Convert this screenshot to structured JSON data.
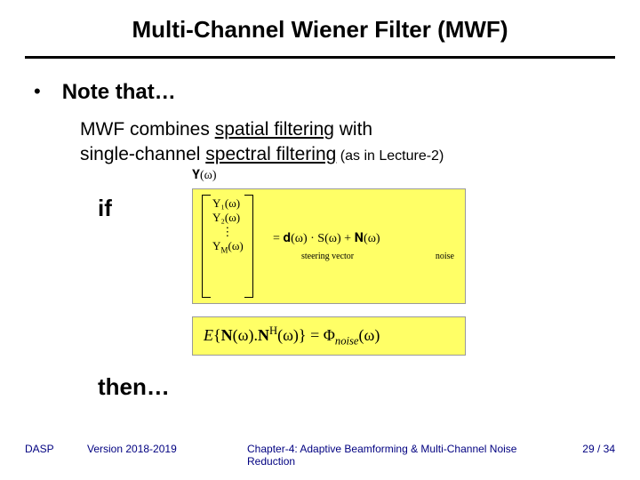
{
  "title": "Multi-Channel Wiener Filter (MWF)",
  "bullet": "Note that…",
  "line1_a": "MWF combines ",
  "line1_b": "spatial filtering",
  "line1_c": " with",
  "line2_a": "single-channel ",
  "line2_b": "spectral filtering",
  "line2_c": " (as in Lecture-2)",
  "if": "if",
  "then": "then…",
  "vec_head": "𝐘(ω)",
  "vec_y1": "Y₁(ω)",
  "vec_y2": "Y₂(ω)",
  "vec_dots": "⋮",
  "vec_ym": "Y_M(ω)",
  "rhs": "=  𝐝(ω) · S(ω) + 𝐍(ω)",
  "steer": "steering vector",
  "noise": "noise",
  "eq2": "E{𝐍(ω).𝐍ᴴ(ω)} = Φ_noise(ω)",
  "footer": {
    "left": "DASP",
    "ver": "Version 2018-2019",
    "chap": "Chapter-4: Adaptive Beamforming & Multi-Channel Noise Reduction",
    "page": "29 / 34"
  }
}
